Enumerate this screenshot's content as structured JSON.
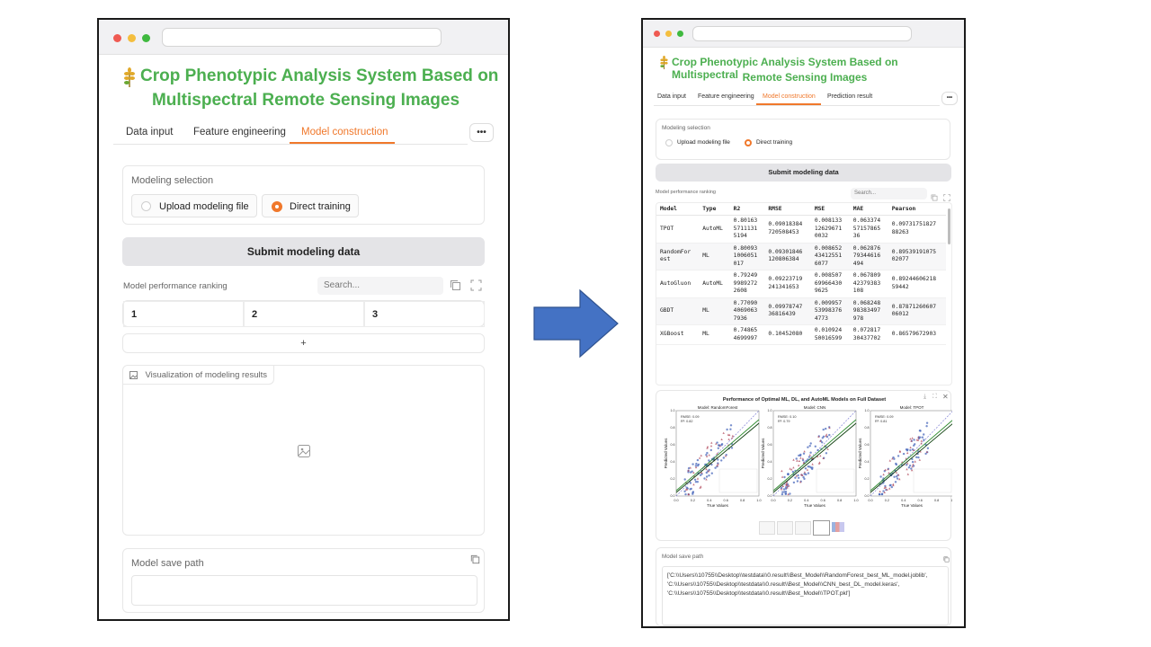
{
  "left": {
    "title_line1": "Crop Phenotypic Analysis System Based on",
    "title_line2": "Multispectral Remote Sensing Images",
    "tabs": [
      "Data input",
      "Feature engineering",
      "Model construction"
    ],
    "more": "•••",
    "modeling_selection_label": "Modeling selection",
    "option_upload": "Upload modeling file",
    "option_direct": "Direct training",
    "submit": "Submit modeling data",
    "ranking_label": "Model performance ranking",
    "search_placeholder": "Search...",
    "grid_headers": [
      "1",
      "2",
      "3"
    ],
    "add_row": "+",
    "visualization_label": "Visualization of modeling results",
    "save_path_label": "Model save path"
  },
  "right": {
    "title_line1": "Crop Phenotypic Analysis System Based on Multispectral",
    "title_line2": "Remote Sensing Images",
    "tabs": [
      "Data input",
      "Feature engineering",
      "Model construction",
      "Prediction result"
    ],
    "more": "•••",
    "modeling_selection_label": "Modeling selection",
    "option_upload": "Upload modeling file",
    "option_direct": "Direct training",
    "submit": "Submit modeling data",
    "ranking_label": "Model performance ranking",
    "search_placeholder": "Search...",
    "table": {
      "headers": [
        "Model",
        "Type",
        "R2",
        "RMSE",
        "MSE",
        "MAE",
        "Pearson"
      ],
      "rows": [
        [
          "TPOT",
          "AutoML",
          "0.80163\n5711131\n5194",
          "0.09018384\n720508453",
          "0.008133\n12629671\n0032",
          "0.063374\n57157865\n36",
          "0.09731751827\n88263"
        ],
        [
          "RandomFor\nest",
          "ML",
          "0.80093\n1006051\n017",
          "0.09301846\n120806384",
          "0.008652\n43412551\n6077",
          "0.062876\n79344616\n494",
          "0.89539191075\n02077"
        ],
        [
          "AutoGluon",
          "AutoML",
          "0.79249\n9989272\n2608",
          "0.09223719\n241341653",
          "0.008507\n69966430\n9625",
          "0.067809\n42379383\n108",
          "0.89244606218\n59442"
        ],
        [
          "GBDT",
          "ML",
          "0.77090\n4069063\n7936",
          "0.09978747\n36816439",
          "0.009957\n53998376\n4773",
          "0.068248\n98383497\n978",
          "0.87871260607\n06012"
        ],
        [
          "XGBoost",
          "ML",
          "0.74865\n4699997",
          "0.10452080",
          "0.010924\n50016599",
          "0.072817\n30437702",
          "0.86579672903"
        ]
      ]
    },
    "plot": {
      "title": "Performance of Optimal ML, DL, and AutoML Models on Full Dataset",
      "panels": [
        {
          "model": "Model: RandomForest",
          "stats": "RMSE: 0.09\nR²: 0.82"
        },
        {
          "model": "Model: CNN",
          "stats": "RMSE: 0.10\nR²: 0.79"
        },
        {
          "model": "Model: TPOT",
          "stats": "RMSE: 0.09\nR²: 0.81"
        }
      ],
      "xlabel": "True Values",
      "ylabel": "Predicted Values",
      "ticks": [
        "0.0",
        "0.2",
        "0.4",
        "0.6",
        "0.8",
        "1.0"
      ],
      "colors": {
        "train": "#3f5fb8",
        "test": "#b0475a",
        "fit_train": "#2e8b2e",
        "fit_test": "#0b3d0b",
        "ideal": "#7070d0"
      }
    },
    "save_path_label": "Model save path",
    "save_paths": [
      "['C:\\\\Users\\\\10755\\\\Desktop\\\\testdata\\\\0.result\\\\Best_Model\\\\RandomForest_best_ML_model.joblib',",
      "'C:\\\\Users\\\\10755\\\\Desktop\\\\testdata\\\\0.result\\\\Best_Model\\\\CNN_best_DL_model.keras',",
      "'C:\\\\Users\\\\10755\\\\Desktop\\\\testdata\\\\0.result\\\\Best_Model\\\\TPOT.pkl']"
    ]
  },
  "colors": {
    "accent": "#f0782b",
    "title_green": "#4caf50",
    "arrow_blue": "#4472c4"
  }
}
